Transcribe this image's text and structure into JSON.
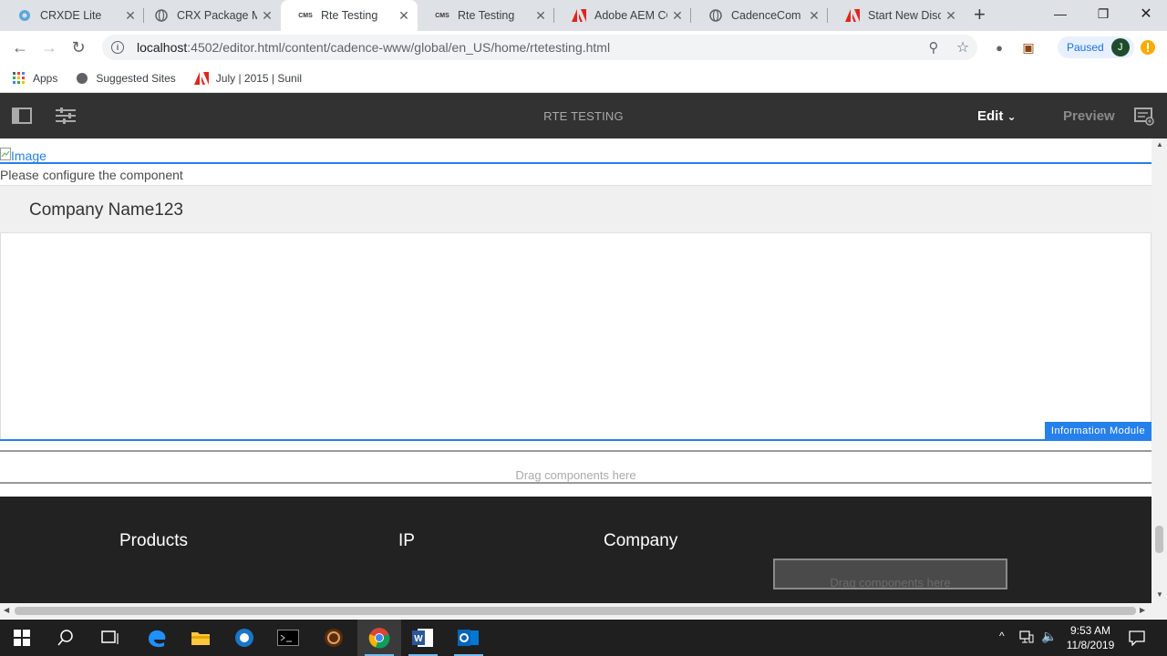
{
  "browser": {
    "tabs": [
      {
        "title": "CRXDE Lite",
        "icon": "crxde-icon"
      },
      {
        "title": "CRX Package Ma",
        "icon": "globe-icon"
      },
      {
        "title": "Rte Testing",
        "icon": "cms-icon"
      },
      {
        "title": "Rte Testing",
        "icon": "cms-icon"
      },
      {
        "title": "Adobe AEM CQ",
        "icon": "adobe-icon"
      },
      {
        "title": "CadenceCom - I",
        "icon": "globe-icon"
      },
      {
        "title": "Start New Discu",
        "icon": "adobe-icon"
      }
    ],
    "url_host": "localhost",
    "url_path": ":4502/editor.html/content/cadence-www/global/en_US/home/rtetesting.html",
    "profile_status": "Paused",
    "profile_initial": "J",
    "bookmarks": [
      "Apps",
      "Suggested Sites",
      "July | 2015 | Sunil"
    ]
  },
  "editor": {
    "page_title": "RTE TESTING",
    "mode_label": "Edit",
    "preview_label": "Preview"
  },
  "page": {
    "image_alt": "Image",
    "configure_text": "Please configure the component",
    "company_name": "Company Name123",
    "info_module_label": "Information Module",
    "drag_placeholder": "Drag components here",
    "footer_columns": [
      "Products",
      "IP",
      "Company"
    ],
    "footer_drag_placeholder": "Drag components here"
  },
  "taskbar": {
    "time": "9:53 AM",
    "date": "11/8/2019"
  }
}
